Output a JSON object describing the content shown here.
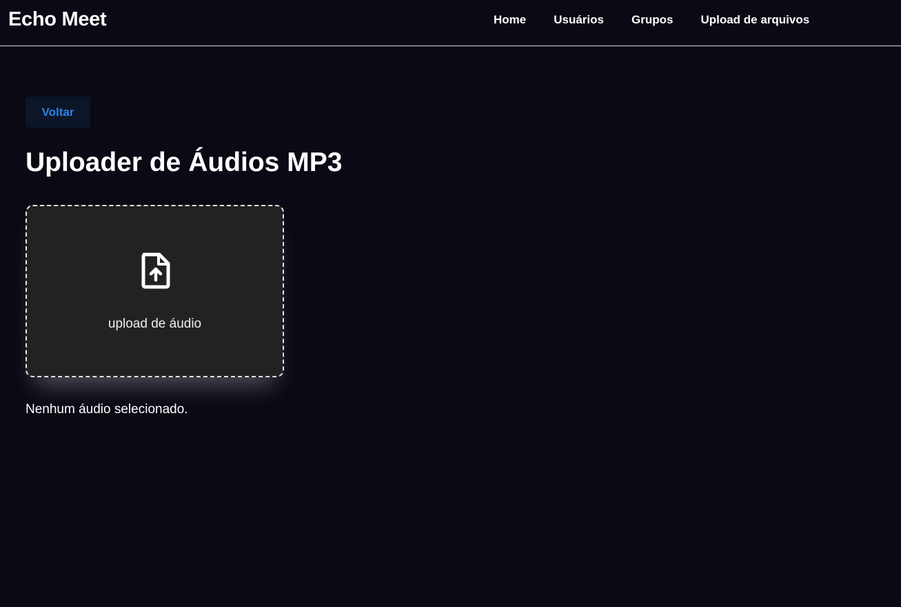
{
  "header": {
    "brand": "Echo Meet",
    "nav": [
      {
        "label": "Home"
      },
      {
        "label": "Usuários"
      },
      {
        "label": "Grupos"
      },
      {
        "label": "Upload de arquivos"
      }
    ]
  },
  "main": {
    "back_label": "Voltar",
    "title": "Uploader de Áudios MP3",
    "upload": {
      "icon": "file-upload-icon",
      "label": "upload de áudio"
    },
    "status": "Nenhum áudio selecionado."
  },
  "colors": {
    "background": "#0a0914",
    "accent": "#2f7fe3",
    "upload_box": "#222222"
  }
}
